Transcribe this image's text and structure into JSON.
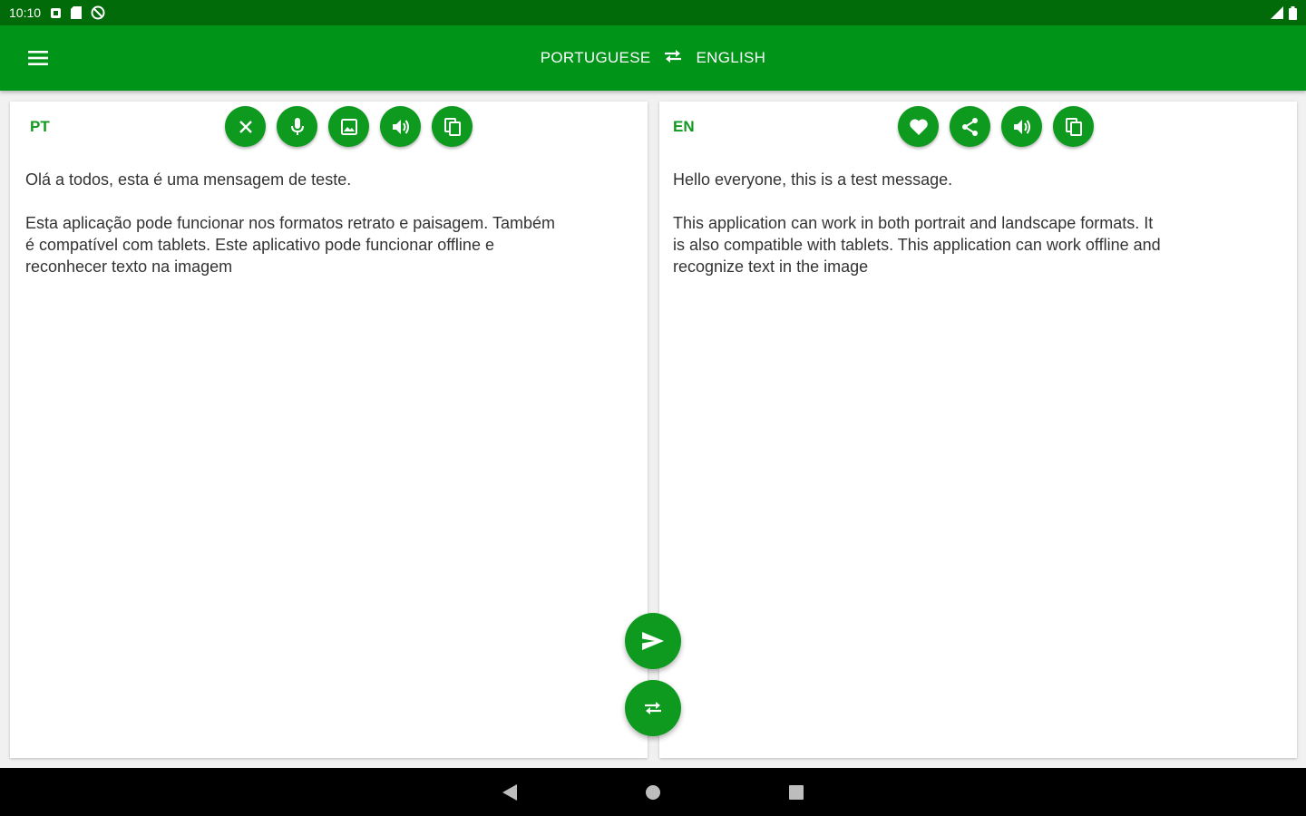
{
  "status_bar": {
    "time": "10:10",
    "icons": [
      "notification-square-icon",
      "sd-card-icon",
      "no-data-icon"
    ],
    "right_icons": [
      "signal-icon",
      "battery-icon"
    ]
  },
  "app_bar": {
    "menu_icon": "hamburger-menu-icon",
    "source_language": "PORTUGUESE",
    "target_language": "ENGLISH",
    "swap_icon": "swap-arrows-icon"
  },
  "source_panel": {
    "lang_code": "PT",
    "actions": [
      "clear",
      "microphone",
      "image",
      "speak",
      "copy"
    ],
    "text": "Olá a todos, esta é uma mensagem de teste.\n\nEsta aplicação pode funcionar nos formatos retrato e paisagem. Também\né compatível com tablets. Este aplicativo pode funcionar offline e\nreconhecer texto na imagem"
  },
  "target_panel": {
    "lang_code": "EN",
    "actions": [
      "favorite",
      "share",
      "speak",
      "copy"
    ],
    "text": "Hello everyone, this is a test message.\n\nThis application can work in both portrait and landscape formats. It\nis also compatible with tablets. This application can work offline and\nrecognize text in the image"
  },
  "fabs": {
    "translate": "send-icon",
    "swap": "swap-arrows-icon"
  },
  "nav_bar": {
    "back": "back-triangle-icon",
    "home": "home-circle-icon",
    "recents": "recents-square-icon"
  },
  "colors": {
    "status_bar": "#006b08",
    "app_bar": "#009419",
    "accent": "#0e9a1f",
    "lang_code": "#12991f"
  }
}
